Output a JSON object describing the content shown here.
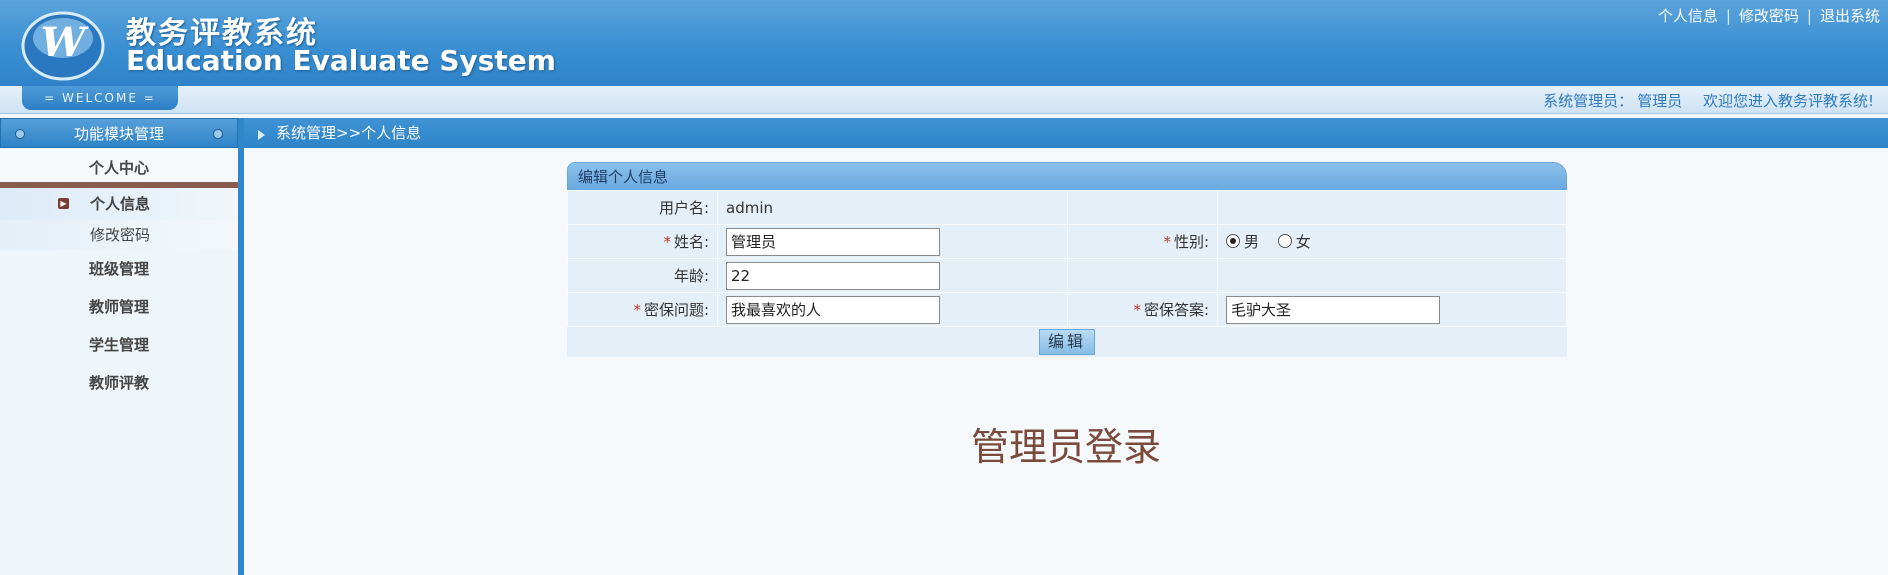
{
  "header": {
    "title_cn": "教务评教系统",
    "title_en": "Education Evaluate System",
    "logo_letter": "W",
    "links": [
      "个人信息",
      "修改密码",
      "退出系统"
    ]
  },
  "welcome": {
    "tab_label": "= WELCOME =",
    "role_label": "系统管理员：",
    "user_name": "管理员",
    "greeting": "欢迎您进入教务评教系统!"
  },
  "sidebar": {
    "header": "功能模块管理",
    "group_label": "个人中心",
    "items": [
      {
        "label": "个人信息",
        "active": true
      },
      {
        "label": "修改密码",
        "active": false
      }
    ],
    "menus": [
      "班级管理",
      "教师管理",
      "学生管理",
      "教师评教"
    ]
  },
  "breadcrumb": "系统管理>>个人信息",
  "form": {
    "title": "编辑个人信息",
    "username_label": "用户名:",
    "username_value": "admin",
    "name_label": "姓名:",
    "name_value": "管理员",
    "gender_label": "性别:",
    "gender_options": [
      "男",
      "女"
    ],
    "gender_selected": "男",
    "age_label": "年龄:",
    "age_value": "22",
    "question_label": "密保问题:",
    "question_value": "我最喜欢的人",
    "answer_label": "密保答案:",
    "answer_value": "毛驴大圣",
    "submit_label": "编辑",
    "required_mark": "*"
  },
  "page_heading": "管理员登录",
  "colors": {
    "header_blue": "#3a8fd2",
    "accent_brown": "#7a4a3d"
  }
}
